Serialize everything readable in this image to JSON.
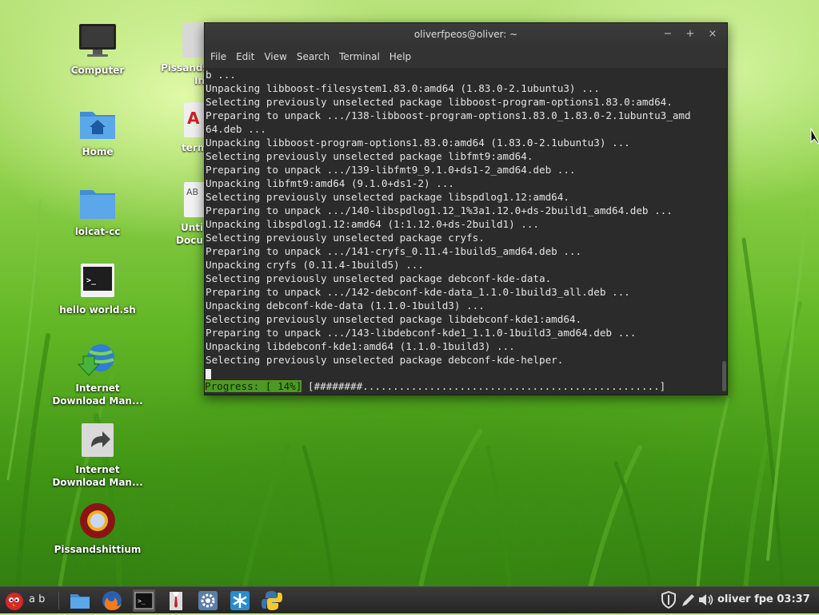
{
  "desktop": {
    "icons": [
      {
        "label": "Computer"
      },
      {
        "label": "Home"
      },
      {
        "label": "lolcat-cc"
      },
      {
        "label": "hello world.sh"
      },
      {
        "label": "Internet Download Man..."
      },
      {
        "label": "Internet Download Man..."
      },
      {
        "label": "Pissandshittium"
      }
    ],
    "partial_icons": [
      {
        "label": "Pissands"
      },
      {
        "label": "In"
      },
      {
        "label": "term"
      },
      {
        "label": "Unti"
      },
      {
        "label": "Docu"
      }
    ]
  },
  "terminal": {
    "title": "oliverfpeos@oliver: ~",
    "window_buttons": {
      "minimize": "−",
      "maximize": "+",
      "close": "×"
    },
    "menu": [
      "File",
      "Edit",
      "View",
      "Search",
      "Terminal",
      "Help"
    ],
    "lines": [
      "b ...",
      "Unpacking libboost-filesystem1.83.0:amd64 (1.83.0-2.1ubuntu3) ...",
      "Selecting previously unselected package libboost-program-options1.83.0:amd64.",
      "Preparing to unpack .../138-libboost-program-options1.83.0_1.83.0-2.1ubuntu3_amd",
      "64.deb ...",
      "Unpacking libboost-program-options1.83.0:amd64 (1.83.0-2.1ubuntu3) ...",
      "Selecting previously unselected package libfmt9:amd64.",
      "Preparing to unpack .../139-libfmt9_9.1.0+ds1-2_amd64.deb ...",
      "Unpacking libfmt9:amd64 (9.1.0+ds1-2) ...",
      "Selecting previously unselected package libspdlog1.12:amd64.",
      "Preparing to unpack .../140-libspdlog1.12_1%3a1.12.0+ds-2build1_amd64.deb ...",
      "Unpacking libspdlog1.12:amd64 (1:1.12.0+ds-2build1) ...",
      "Selecting previously unselected package cryfs.",
      "Preparing to unpack .../141-cryfs_0.11.4-1build5_amd64.deb ...",
      "Unpacking cryfs (0.11.4-1build5) ...",
      "Selecting previously unselected package debconf-kde-data.",
      "Preparing to unpack .../142-debconf-kde-data_1.1.0-1build3_all.deb ...",
      "Unpacking debconf-kde-data (1.1.0-1build3) ...",
      "Selecting previously unselected package libdebconf-kde1:amd64.",
      "Preparing to unpack .../143-libdebconf-kde1_1.1.0-1build3_amd64.deb ...",
      "Unpacking libdebconf-kde1:amd64 (1.1.0-1build3) ...",
      "Selecting previously unselected package debconf-kde-helper."
    ],
    "progress_label": "Progress: [ 14%]",
    "progress_bar": " [########.................................................]",
    "progress_percent": 14
  },
  "taskbar": {
    "menu_text": "a b",
    "user_clock": "oliver fpe 03:37",
    "launchers": [
      "folder-icon",
      "firefox-icon",
      "terminal-icon",
      "suit-icon",
      "settings-icon",
      "snowflake-icon",
      "python-icon"
    ],
    "tray_icons": [
      "shield-icon",
      "pen-icon",
      "volume-icon"
    ]
  },
  "colors": {
    "terminal_bg": "#2b2b2b",
    "progress_green": "#4d9a22",
    "taskbar_bg": "#2e2e2e"
  }
}
